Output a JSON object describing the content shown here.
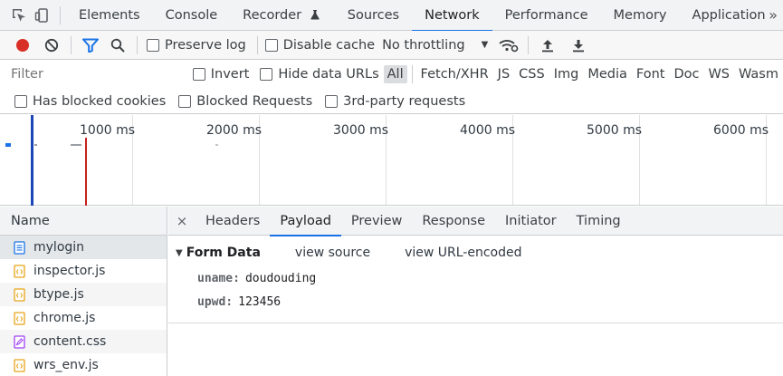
{
  "tabs": [
    {
      "label": "Elements"
    },
    {
      "label": "Console"
    },
    {
      "label": "Recorder"
    },
    {
      "label": "Sources"
    },
    {
      "label": "Network"
    },
    {
      "label": "Performance"
    },
    {
      "label": "Memory"
    },
    {
      "label": "Application"
    }
  ],
  "more_label": "»",
  "toolbar": {
    "preserve_log": "Preserve log",
    "disable_cache": "Disable cache",
    "throttling": "No throttling"
  },
  "filter": {
    "placeholder": "Filter",
    "invert": "Invert",
    "hide_data_urls": "Hide data URLs",
    "types": [
      "All",
      "Fetch/XHR",
      "JS",
      "CSS",
      "Img",
      "Media",
      "Font",
      "Doc",
      "WS",
      "Wasm"
    ]
  },
  "blocked": {
    "cookies": "Has blocked cookies",
    "requests": "Blocked Requests",
    "third_party": "3rd-party requests"
  },
  "timeline": {
    "ticks": [
      "1000 ms",
      "2000 ms",
      "3000 ms",
      "4000 ms",
      "5000 ms",
      "6000 ms"
    ]
  },
  "name_panel": {
    "header": "Name",
    "requests": [
      {
        "name": "mylogin",
        "icon": "document-icon"
      },
      {
        "name": "inspector.js",
        "icon": "script-icon"
      },
      {
        "name": "btype.js",
        "icon": "script-icon"
      },
      {
        "name": "chrome.js",
        "icon": "script-icon"
      },
      {
        "name": "content.css",
        "icon": "stylesheet-icon"
      },
      {
        "name": "wrs_env.js",
        "icon": "script-icon"
      }
    ]
  },
  "detail": {
    "close": "×",
    "tabs": [
      "Headers",
      "Payload",
      "Preview",
      "Response",
      "Initiator",
      "Timing"
    ],
    "form_title": "Form Data",
    "view_source": "view source",
    "view_url_encoded": "view URL-encoded",
    "fields": [
      {
        "key": "uname:",
        "value": "doudouding"
      },
      {
        "key": "upwd:",
        "value": "123456"
      }
    ]
  },
  "colors": {
    "accent": "#1a73e8",
    "record": "#d93025",
    "filter_active": "#1a73e8",
    "dom_content_loaded": "#1a46b8",
    "load": "#c5221f",
    "script_icon": "#e8a317",
    "css_icon": "#a142f4"
  }
}
